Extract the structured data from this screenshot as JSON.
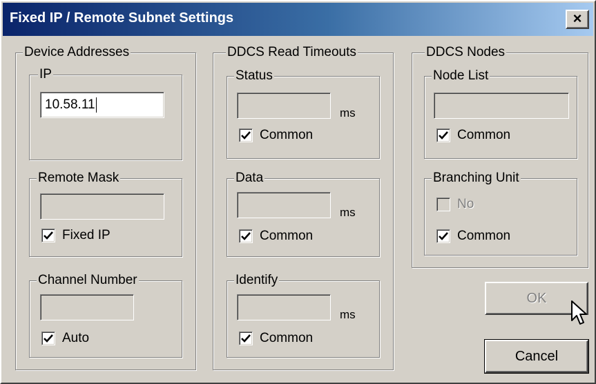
{
  "window": {
    "title": "Fixed IP / Remote Subnet Settings",
    "close_label": "×"
  },
  "device_addresses": {
    "label": "Device Addresses",
    "ip": {
      "label": "IP",
      "value": "10.58.11"
    },
    "remote_mask": {
      "label": "Remote Mask",
      "value": "",
      "checkbox": {
        "label": "Fixed IP",
        "checked": true
      }
    },
    "channel_number": {
      "label": "Channel Number",
      "value": "",
      "checkbox": {
        "label": "Auto",
        "checked": true
      }
    }
  },
  "ddcs_read_timeouts": {
    "label": "DDCS Read Timeouts",
    "status": {
      "label": "Status",
      "value": "",
      "unit": "ms",
      "checkbox": {
        "label": "Common",
        "checked": true
      }
    },
    "data": {
      "label": "Data",
      "value": "",
      "unit": "ms",
      "checkbox": {
        "label": "Common",
        "checked": true
      }
    },
    "identify": {
      "label": "Identify",
      "value": "",
      "unit": "ms",
      "checkbox": {
        "label": "Common",
        "checked": true
      }
    }
  },
  "ddcs_nodes": {
    "label": "DDCS Nodes",
    "node_list": {
      "label": "Node List",
      "value": "",
      "checkbox": {
        "label": "Common",
        "checked": true
      }
    },
    "branching_unit": {
      "label": "Branching Unit",
      "no_checkbox": {
        "label": "No",
        "checked": false,
        "disabled": true
      },
      "common_checkbox": {
        "label": "Common",
        "checked": true
      }
    }
  },
  "buttons": {
    "ok": "OK",
    "cancel": "Cancel"
  },
  "colors": {
    "face": "#d4d0c8",
    "title_start": "#0a246a",
    "title_end": "#a6caf0"
  },
  "icons": {
    "check": "checkmark-icon",
    "cursor": "mouse-pointer-icon"
  }
}
